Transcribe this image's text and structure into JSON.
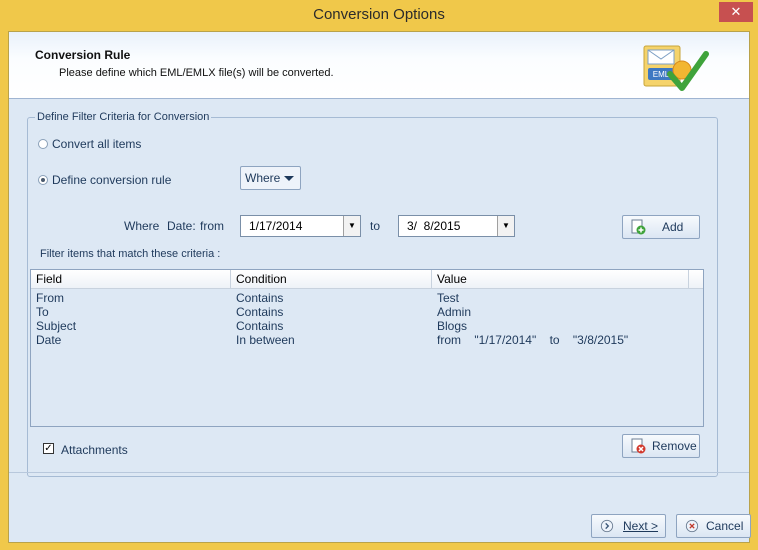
{
  "window": {
    "title": "Conversion Options",
    "close_glyph": "✕"
  },
  "header": {
    "title": "Conversion Rule",
    "subtitle": "Please define which EML/EMLX file(s) will be converted.",
    "icon_label": "EML",
    "icon": "eml-checkmark-icon"
  },
  "filter_group": {
    "legend": "Define Filter Criteria for Conversion",
    "convert_all_label": "Convert all items",
    "convert_all_selected": false,
    "define_rule_label": "Define conversion rule",
    "define_rule_selected": true,
    "where_dropdown": "Where",
    "where_label": "Where",
    "date_label": "Date:",
    "from_label": "from",
    "from_date": "1/17/2014",
    "to_label": "to",
    "to_date": "3/  8/2015",
    "add_button": "Add",
    "criteria_label": "Filter items that match these criteria :"
  },
  "criteria_table": {
    "columns": [
      "Field",
      "Condition",
      "Value"
    ],
    "rows": [
      {
        "field": "From",
        "condition": "Contains",
        "value": "Test"
      },
      {
        "field": "To",
        "condition": "Contains",
        "value": "Admin"
      },
      {
        "field": "Subject",
        "condition": "Contains",
        "value": "Blogs"
      },
      {
        "field": "Date",
        "condition": "In between",
        "value": "from    \"1/17/2014\"    to    \"3/8/2015\""
      }
    ]
  },
  "attachments": {
    "label": "Attachments",
    "checked": true,
    "check_glyph": "✓"
  },
  "remove_button": "Remove",
  "next_button": "Next >",
  "cancel_button": "Cancel",
  "colors": {
    "title_bar": "#f0c84a",
    "client": "#dde8f4",
    "close": "#c75050",
    "accent_text": "#1e395b"
  }
}
